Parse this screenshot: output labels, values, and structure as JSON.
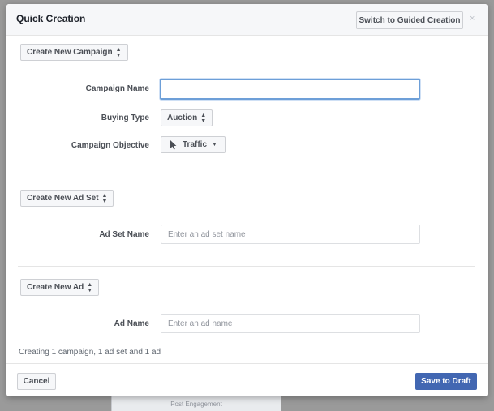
{
  "dialog": {
    "title": "Quick Creation",
    "switch_label": "Switch to Guided Creation",
    "close_glyph": "×"
  },
  "campaign": {
    "section_label": "Create New Campaign",
    "name_label": "Campaign Name",
    "name_value": "",
    "buying_type_label": "Buying Type",
    "buying_type_value": "Auction",
    "objective_label": "Campaign Objective",
    "objective_value": "Traffic",
    "objective_icon": "cursor-arrow-icon"
  },
  "ad_set": {
    "section_label": "Create New Ad Set",
    "name_label": "Ad Set Name",
    "name_placeholder": "Enter an ad set name"
  },
  "ad": {
    "section_label": "Create New Ad",
    "name_label": "Ad Name",
    "name_placeholder": "Enter an ad name"
  },
  "footer": {
    "summary": "Creating 1 campaign, 1 ad set and 1 ad",
    "cancel_label": "Cancel",
    "save_label": "Save to Draft"
  },
  "background": {
    "partial_text": "Post Engagement"
  },
  "colors": {
    "primary": "#4267b2",
    "focus_ring": "#6d9fd8",
    "header_bg": "#f6f7f9"
  }
}
